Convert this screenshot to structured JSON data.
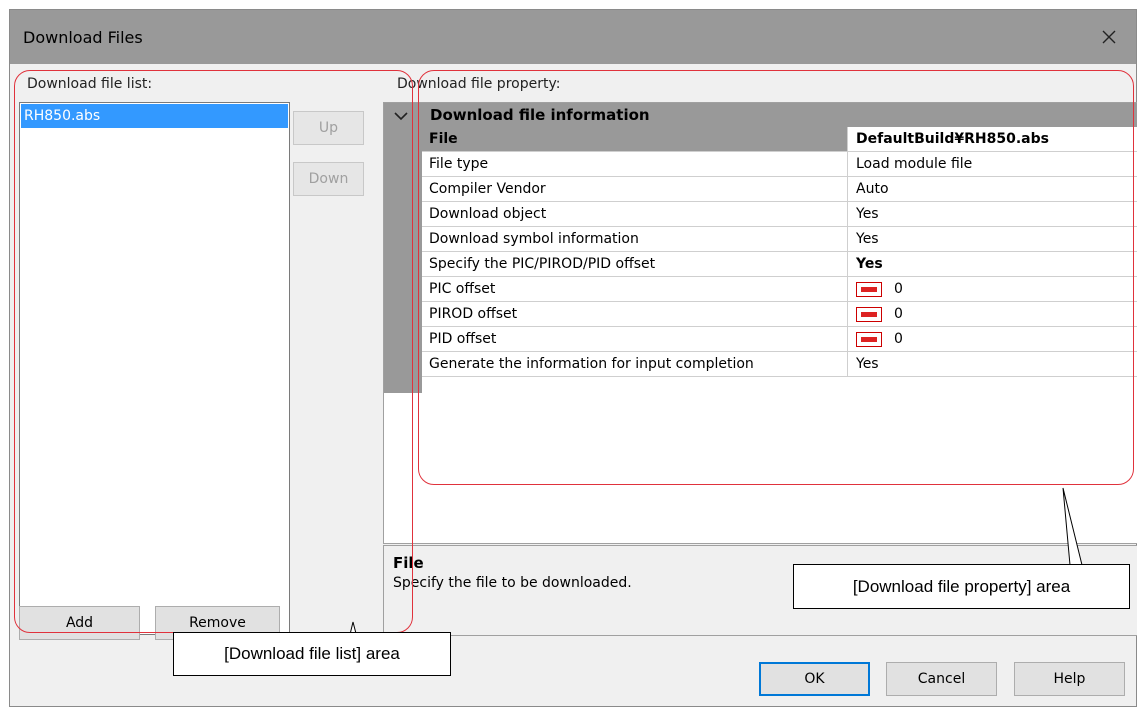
{
  "window": {
    "title": "Download Files",
    "close_icon": "close-icon"
  },
  "file_list": {
    "label": "Download file list:",
    "items": [
      "RH850.abs"
    ],
    "up_label": "Up",
    "down_label": "Down",
    "add_label": "Add",
    "remove_label": "Remove"
  },
  "property": {
    "label": "Download file property:",
    "category": "Download file information",
    "collapse_icon": "chevron-down-icon",
    "hex_icon": "hex-icon",
    "rows": [
      {
        "key": "File",
        "value": "DefaultBuild¥RH850.abs"
      },
      {
        "key": "File type",
        "value": "Load module file"
      },
      {
        "key": "Compiler Vendor",
        "value": "Auto"
      },
      {
        "key": "Download object",
        "value": "Yes"
      },
      {
        "key": "Download symbol information",
        "value": "Yes"
      },
      {
        "key": "Specify the PIC/PIROD/PID offset",
        "value": "Yes"
      },
      {
        "key": "PIC offset",
        "value": "0"
      },
      {
        "key": "PIROD offset",
        "value": "0"
      },
      {
        "key": "PID offset",
        "value": "0"
      },
      {
        "key": "Generate the information for input completion",
        "value": "Yes"
      }
    ],
    "description_title": "File",
    "description_text": "Specify the file to be downloaded."
  },
  "buttons": {
    "ok_label": "OK",
    "cancel_label": "Cancel",
    "help_label": "Help"
  },
  "callouts": {
    "file_list_area": "[Download file list] area",
    "file_property_area": "[Download file property] area",
    "outline_color": "#e0323c"
  }
}
